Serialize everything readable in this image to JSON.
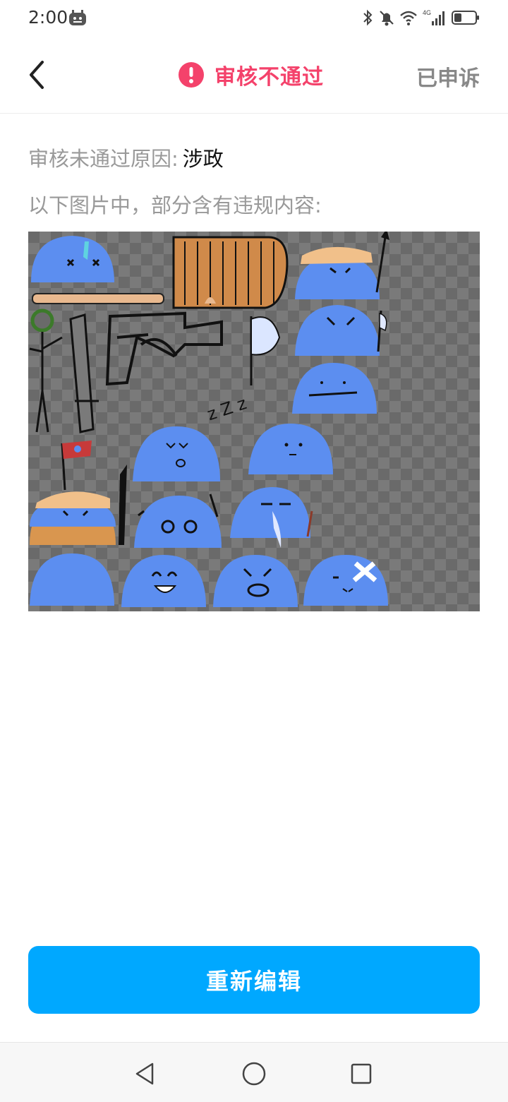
{
  "status_bar": {
    "time": "2:00",
    "network_label": "4G",
    "icons": [
      "android-app-icon",
      "bluetooth-icon",
      "bell-off-icon",
      "wifi-icon",
      "signal-icon",
      "battery-icon"
    ]
  },
  "header": {
    "back_icon": "chevron-left-icon",
    "status_icon": "alert-circle-icon",
    "title": "审核不通过",
    "title_color": "#f4426b",
    "right_label": "已申诉"
  },
  "review": {
    "reason_label": "审核未通过原因:",
    "reason_value": "涉政",
    "violation_note": "以下图片中，部分含有违规内容:"
  },
  "sticker_sheet": {
    "description_icon": "sticker-sheet-image",
    "background": "checkerboard",
    "zzz_text": "z Z z"
  },
  "footer": {
    "button_label": "重新编辑",
    "button_color": "#00a8ff"
  },
  "system_nav": {
    "icons": [
      "back-triangle-icon",
      "home-circle-icon",
      "recents-square-icon"
    ]
  }
}
